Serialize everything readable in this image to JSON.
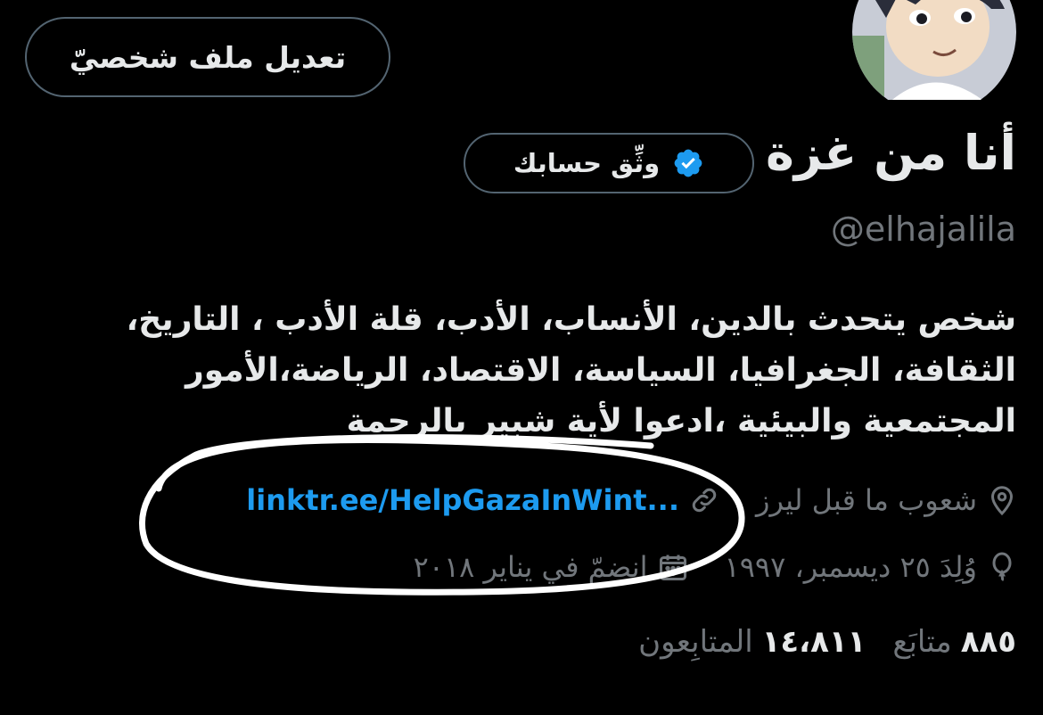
{
  "profile": {
    "edit_button_label": "تعديل ملف شخصيّ",
    "display_name": "أنا من غزة",
    "verify_label": "وثِّق حسابك",
    "handle": "@elhajalila",
    "bio_lines": [
      "شخص يتحدث بالدين، الأنساب، الأدب، قلة الأدب ، التاريخ،",
      "الثقافة، الجغرافيا، السياسة، الاقتصاد، الرياضة،الأمور",
      "المجتمعية والبيئية ،ادعوا لأية شبير بالرحمة"
    ],
    "location": "شعوب ما قبل ليرز",
    "link": "linktr.ee/HelpGazaInWint...",
    "birthday": "وُلِدَ ٢٥ ديسمبر، ١٩٩٧",
    "joined": "انضمّ في يناير ٢٠١٨",
    "following_count": "٨٨٥",
    "following_label": "متابَع",
    "followers_count": "١٤،٨١١",
    "followers_label": "المتابِعون"
  },
  "icons": {
    "verified": "verified-badge-icon",
    "location": "location-pin-icon",
    "link": "link-icon",
    "birthday": "balloon-icon",
    "joined": "calendar-icon"
  },
  "colors": {
    "background": "#000000",
    "text_primary": "#e7e9ea",
    "text_secondary": "#71767b",
    "link": "#1d9bf0",
    "verified_badge": "#1d9bf0",
    "border": "#536471",
    "annotation": "#ffffff"
  }
}
